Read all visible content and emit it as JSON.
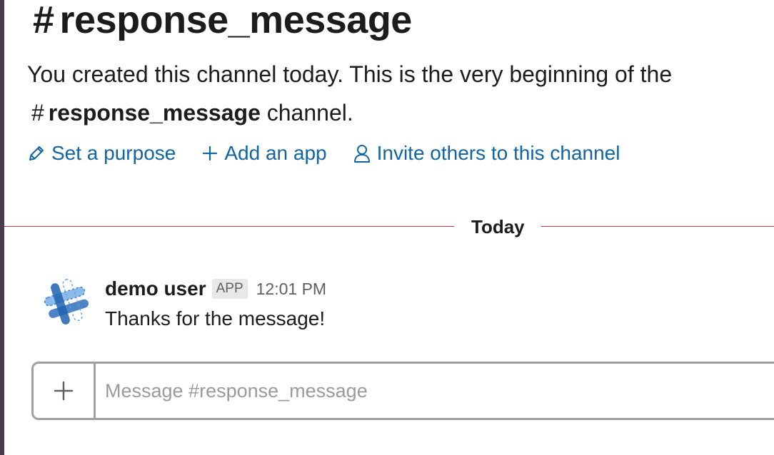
{
  "channel": {
    "hash": "#",
    "name": "response_message"
  },
  "intro": {
    "text_before": "You created this channel today. This is the very beginning of the",
    "hash": "#",
    "channel_name": "response_message",
    "text_after": "channel."
  },
  "actions": {
    "set_purpose": {
      "icon": "pencil-icon",
      "label": "Set a purpose"
    },
    "add_app": {
      "icon": "plus-icon",
      "label": "Add an app"
    },
    "invite": {
      "icon": "person-icon",
      "label": "Invite others to this channel"
    }
  },
  "divider": {
    "label": "Today",
    "color": "#d03a4e"
  },
  "message": {
    "avatar_icon": "slack-app-logo-icon",
    "username": "demo user",
    "badge": "APP",
    "timestamp": "12:01 PM",
    "text": "Thanks for the message!"
  },
  "composer": {
    "add_icon": "plus-icon",
    "placeholder": "Message #response_message",
    "value": ""
  },
  "colors": {
    "link": "#1264a3",
    "text": "#1d1c1d",
    "muted": "#616061",
    "sidebar_edge": "#4a3b4b"
  }
}
